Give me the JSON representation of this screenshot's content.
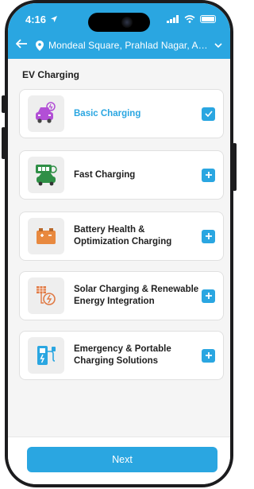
{
  "status_bar": {
    "time": "4:16"
  },
  "header": {
    "location": "Mondeal Square, Prahlad Nagar, Ahmedabad"
  },
  "section": {
    "title": "EV Charging"
  },
  "options": [
    {
      "label": "Basic Charging",
      "icon": "ev-car-plug-icon",
      "selected": true
    },
    {
      "label": "Fast Charging",
      "icon": "fast-charging-car-icon",
      "selected": false
    },
    {
      "label": "Battery Health &\nOptimization Charging",
      "icon": "battery-icon",
      "selected": false
    },
    {
      "label": "Solar Charging & Renewable\nEnergy Integration",
      "icon": "solar-panel-icon",
      "selected": false
    },
    {
      "label": "Emergency & Portable\nCharging Solutions",
      "icon": "ev-charging-station-icon",
      "selected": false
    }
  ],
  "footer": {
    "next_label": "Next"
  },
  "colors": {
    "accent": "#2aa6e1"
  }
}
